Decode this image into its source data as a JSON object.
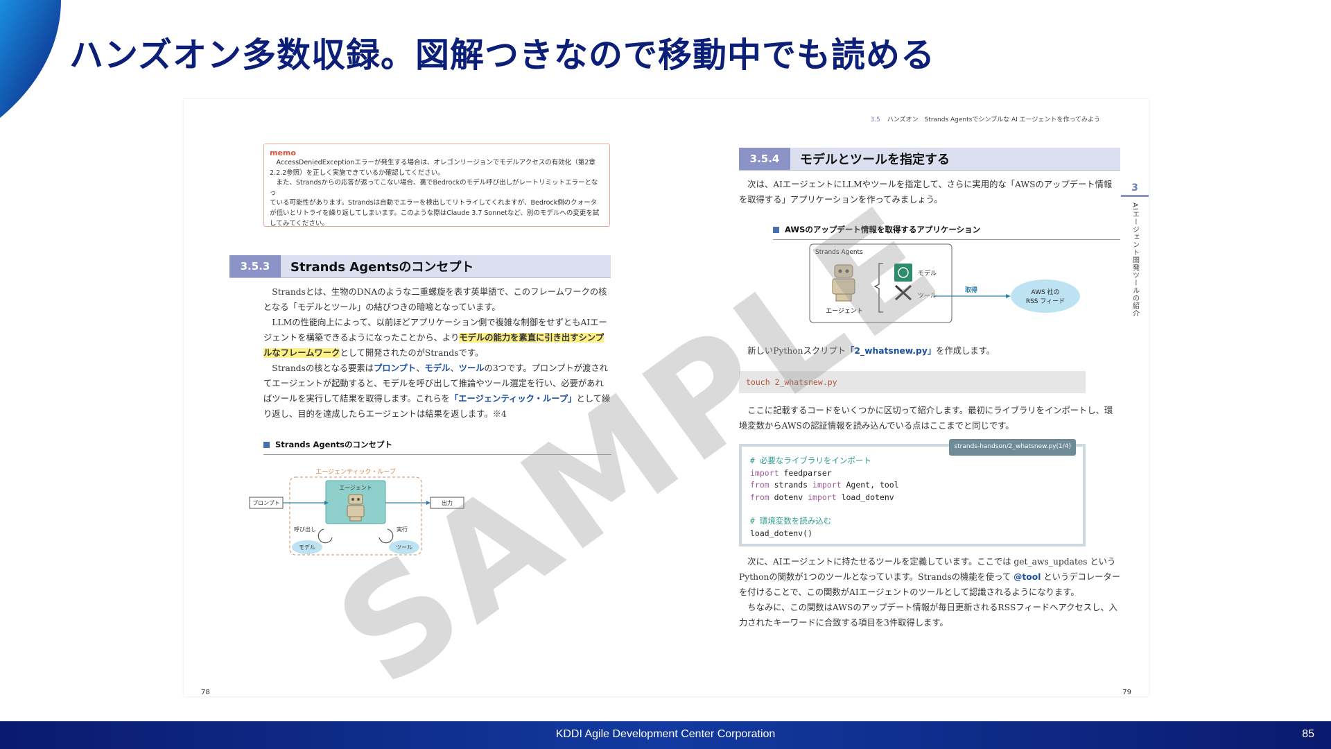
{
  "slide": {
    "title": "ハンズオン多数収録。図解つきなので移動中でも読める",
    "footer": "KDDI Agile Development Center Corporation",
    "page_number": "85",
    "watermark": "SAMPLE"
  },
  "left_page": {
    "memo": {
      "title": "memo",
      "lines": [
        "　AccessDeniedExceptionエラーが発生する場合は、オレゴンリージョンでモデルアクセスの有効化（第2章",
        "2.2.2参照）を正しく実施できているか確認してください。",
        "　また、Strandsからの応答が返ってこない場合、裏でBedrockのモデル呼び出しがレートリミットエラーとなっ",
        "ている可能性があります。Strandsは自動でエラーを検出してリトライしてくれますが、Bedrock側のクォータ",
        "が低いとリトライを繰り返してしまいます。このような際はClaude 3.7 Sonnetなど、別のモデルへの変更を試",
        "してみてください。"
      ]
    },
    "section": {
      "number": "3.5.3",
      "title": "Strands Agentsのコンセプト"
    },
    "p1": "Strandsとは、生物のDNAのような二重螺旋を表す英単語で、このフレームワークの核となる「モデルとツール」の結びつきの暗喩となっています。",
    "p2_a": "LLMの性能向上によって、以前ほどアプリケーション側で複雑な制御をせずともAIエージェントを構築できるようになったことから、より",
    "p2_hl": "モデルの能力を素直に引き出すシンプルなフレームワーク",
    "p2_b": "として開発されたのがStrandsです。",
    "p3_a": "Strandsの核となる要素は",
    "p3_k1": "プロンプト",
    "p3_sep1": "、",
    "p3_k2": "モデル",
    "p3_sep2": "、",
    "p3_k3": "ツール",
    "p3_b": "の3つです。プロンプトが渡されてエージェントが起動すると、モデルを呼び出して推論やツール選定を行い、必要があればツールを実行して結果を取得します。これらを",
    "p3_k4": "「エージェンティック・ループ」",
    "p3_c": "として繰り返し、目的を達成したらエージェントは結果を返します。※4",
    "figure": {
      "caption": "Strands Agentsのコンセプト",
      "loop_label": "エージェンティック・ループ",
      "agent": "エージェント",
      "prompt": "プロンプト",
      "output": "出力",
      "call": "呼び出し",
      "exec": "実行",
      "model": "モデル",
      "tool": "ツール"
    },
    "page_no": "78"
  },
  "right_page": {
    "running_head_num": "3.5",
    "running_head": "ハンズオン　Strands Agentsでシンプルな AI エージェントを作ってみよう",
    "chapter_num": "3",
    "chapter_label": "AIエージェント開発ツールの紹介",
    "section": {
      "number": "3.5.4",
      "title": "モデルとツールを指定する"
    },
    "p1": "次は、AIエージェントにLLMやツールを指定して、さらに実用的な「AWSのアップデート情報を取得する」アプリケーションを作ってみましょう。",
    "figure": {
      "caption": "AWSのアップデート情報を取得するアプリケーション",
      "box_title": "Strands Agents",
      "agent": "エージェント",
      "model": "モデル",
      "tool": "ツール",
      "fetch": "取得",
      "feed_line1": "AWS 社の",
      "feed_line2": "RSS フィード"
    },
    "p2_a": "新しいPythonスクリプト",
    "p2_k": "「2_whatsnew.py」",
    "p2_b": "を作成します。",
    "cmd": "touch 2_whatsnew.py",
    "p3": "ここに記載するコードをいくつかに区切って紹介します。最初にライブラリをインポートし、環境変数からAWSの認証情報を読み込んでいる点はここまでと同じです。",
    "code": {
      "tab": "strands-handson/2_whatsnew.py(1/4)",
      "c1": "# 必要なライブラリをインポート",
      "l1_kw": "import",
      "l1_rest": " feedparser",
      "l2_kw1": "from",
      "l2_mid": " strands ",
      "l2_kw2": "import",
      "l2_rest": " Agent, tool",
      "l3_kw1": "from",
      "l3_mid": " dotenv ",
      "l3_kw2": "import",
      "l3_rest": " load_dotenv",
      "c2": "# 環境変数を読み込む",
      "l4": "load_dotenv()"
    },
    "p4_a": "次に、AIエージェントに持たせるツールを定義しています。ここでは get_aws_updates という Pythonの関数が1つのツールとなっています。Strandsの機能を使って ",
    "p4_k": "@tool",
    "p4_b": " というデコレーターを付けることで、この関数がAIエージェントのツールとして認識されるようになります。",
    "p5": "ちなみに、この関数はAWSのアップデート情報が毎日更新されるRSSフィードへアクセスし、入力されたキーワードに合致する項目を3件取得します。",
    "page_no": "79"
  }
}
